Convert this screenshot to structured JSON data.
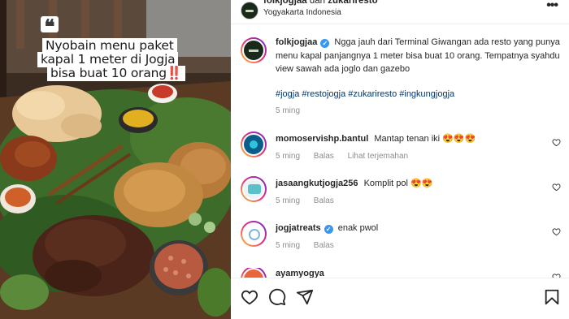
{
  "post": {
    "username": "folkjogjaa",
    "collab_separator": "dan",
    "collab_user": "zukariresto",
    "location": "Yogyakarta Indonesia",
    "more_icon": "more-horizontal-icon"
  },
  "media": {
    "overlay_line1": "Nyobain menu paket",
    "overlay_line2": "kapal 1 meter di Jogja",
    "overlay_line3": "bisa buat 10 orang",
    "overlay_emoji": "‼️",
    "quote_glyph": "❝"
  },
  "caption": {
    "username": "folkjogjaa",
    "text": "Ngga jauh dari Terminal Giwangan ada resto yang punya menu kapal panjangnya 1 meter bisa buat 10 orang. Tempatnya syahdu view sawah ada joglo dan gazebo",
    "hashtags": "#jogja #restojogja #zukariresto #ingkungjogja",
    "time": "5 ming"
  },
  "comments": [
    {
      "username": "momoservishp.bantul",
      "verified": false,
      "text": "Mantap tenan iki 😍😍😍",
      "time": "5 ming",
      "reply_label": "Balas",
      "translate_label": "Lihat terjemahan",
      "avatar_color": "#0b5e8a"
    },
    {
      "username": "jasaangkutjogja256",
      "verified": false,
      "text": "Komplit pol 😍😍",
      "time": "5 ming",
      "reply_label": "Balas",
      "translate_label": "",
      "avatar_color": "#5bc0c8"
    },
    {
      "username": "jogjatreats",
      "verified": true,
      "text": "enak pwol",
      "time": "5 ming",
      "reply_label": "Balas",
      "translate_label": "",
      "avatar_color": "#ffffff"
    },
    {
      "username": "ayamyogya",
      "verified": false,
      "text": "",
      "time": "",
      "reply_label": "",
      "translate_label": "",
      "avatar_color": "#e8663a"
    }
  ],
  "actions": {
    "like_icon": "heart-icon",
    "comment_icon": "comment-icon",
    "share_icon": "share-icon",
    "save_icon": "bookmark-icon"
  },
  "colors": {
    "link": "#00376b",
    "meta": "#8e8e8e",
    "verified": "#3897f0",
    "alarm": "#e02424"
  }
}
